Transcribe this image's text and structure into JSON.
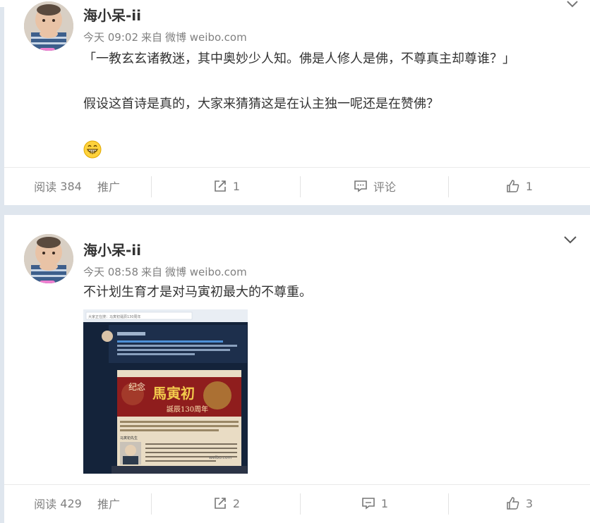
{
  "posts": [
    {
      "username": "海小呆-ii",
      "time": "今天 09:02",
      "source_prefix": "来自",
      "source": "微博 weibo.com",
      "lines": [
        "「一教玄玄诸教迷，其中奥妙少人知。佛是人修人是佛，不尊真主却尊谁？」",
        "假设这首诗是真的，大家来猜猜这是在认主独一呢还是在赞佛？"
      ],
      "emoji_icon": "grin-emoji-icon",
      "actions": {
        "reads_label": "阅读",
        "reads_count": "384",
        "promote_label": "推广",
        "repost_count": "1",
        "comment_label": "评论",
        "like_count": "1"
      }
    },
    {
      "username": "海小呆-ii",
      "time": "今天 08:58",
      "source_prefix": "来自",
      "source": "微博 weibo.com",
      "lines": [
        "不计划生育才是对马寅初最大的不尊重。"
      ],
      "image": {
        "search_text": "大家正在搜：马寅初诞辰130周年",
        "poster_line1": "纪念",
        "poster_line2": "馬寅初",
        "poster_line3": "誕辰130周年",
        "caption": "马寅初先生",
        "watermark": "weibo.com"
      },
      "actions": {
        "reads_label": "阅读",
        "reads_count": "429",
        "promote_label": "推广",
        "repost_count": "2",
        "comment_count": "1",
        "like_count": "3"
      }
    }
  ],
  "colors": {
    "accent": "#ff8200",
    "muted": "#808080",
    "text": "#333333",
    "page_bg": "#dfe6ee"
  }
}
